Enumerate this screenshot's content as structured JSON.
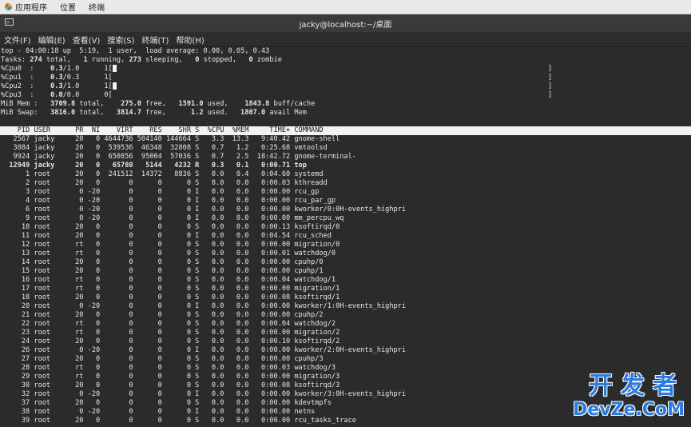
{
  "topbar": {
    "apps": "应用程序",
    "places": "位置",
    "terminal": "终端"
  },
  "window": {
    "title": "jacky@localhost:~/桌面"
  },
  "menubar": [
    "文件(F)",
    "编辑(E)",
    "查看(V)",
    "搜索(S)",
    "终端(T)",
    "帮助(H)"
  ],
  "summary": {
    "top": "top - 04:00:18 up  5:19,  1 user,  load average: 0.00, 0.05, 0.43",
    "tasks": [
      "Tasks: ",
      "274",
      " total,   ",
      "1",
      " running, ",
      "273",
      " sleeping,   ",
      "0",
      " stopped,   ",
      "0",
      " zombie"
    ],
    "cpus": [
      {
        "label": "%Cpu0  :    ",
        "val": "0.3",
        "rest": "/1.0      1["
      },
      {
        "label": "%Cpu1  :    ",
        "val": "0.3",
        "rest": "/0.3      1["
      },
      {
        "label": "%Cpu2  :    ",
        "val": "0.3",
        "rest": "/1.0      1["
      },
      {
        "label": "%Cpu3  :    ",
        "val": "0.0",
        "rest": "/0.0      0["
      }
    ],
    "bracket_close": "]",
    "mem": [
      "MiB Mem :   ",
      "3709.8",
      " total,    ",
      "275.0",
      " free,   ",
      "1591.0",
      " used,    ",
      "1843.8",
      " buff/cache"
    ],
    "swap": [
      "MiB Swap:   ",
      "3816.0",
      " total,   ",
      "3814.7",
      " free,      ",
      "1.2",
      " used.   ",
      "1807.0",
      " avail Mem"
    ]
  },
  "table": {
    "header": "    PID USER      PR  NI    VIRT    RES    SHR S  %CPU  %MEM     TIME+ COMMAND",
    "rows": [
      {
        "text": "   2567 jacky     20   0 4644736 504140 144664 S   3.3  13.3   9:40.42 gnome-shell",
        "bold": false
      },
      {
        "text": "   3084 jacky     20   0  539536  46348  32808 S   0.7   1.2   0:25.68 vmtoolsd",
        "bold": false
      },
      {
        "text": "   9924 jacky     20   0  650856  95004  57036 S   0.7   2.5  18:42.72 gnome-terminal-",
        "bold": false
      },
      {
        "text": "  12949 jacky     20   0   65780   5144   4232 R   0.3   0.1   0:00.71 top",
        "bold": true
      },
      {
        "text": "      1 root      20   0  241512  14372   8836 S   0.0   0.4   0:04.60 systemd",
        "bold": false
      },
      {
        "text": "      2 root      20   0       0      0      0 S   0.0   0.0   0:00.03 kthreadd",
        "bold": false
      },
      {
        "text": "      3 root       0 -20       0      0      0 I   0.0   0.0   0:00.00 rcu_gp",
        "bold": false
      },
      {
        "text": "      4 root       0 -20       0      0      0 I   0.0   0.0   0:00.00 rcu_par_gp",
        "bold": false
      },
      {
        "text": "      6 root       0 -20       0      0      0 I   0.0   0.0   0:00.00 kworker/0:0H-events_highpri",
        "bold": false
      },
      {
        "text": "      9 root       0 -20       0      0      0 I   0.0   0.0   0:00.00 mm_percpu_wq",
        "bold": false
      },
      {
        "text": "     10 root      20   0       0      0      0 S   0.0   0.0   0:00.13 ksoftirqd/0",
        "bold": false
      },
      {
        "text": "     11 root      20   0       0      0      0 I   0.0   0.0   0:04.54 rcu_sched",
        "bold": false
      },
      {
        "text": "     12 root      rt   0       0      0      0 S   0.0   0.0   0:00.00 migration/0",
        "bold": false
      },
      {
        "text": "     13 root      rt   0       0      0      0 S   0.0   0.0   0:00.01 watchdog/0",
        "bold": false
      },
      {
        "text": "     14 root      20   0       0      0      0 S   0.0   0.0   0:00.00 cpuhp/0",
        "bold": false
      },
      {
        "text": "     15 root      20   0       0      0      0 S   0.0   0.0   0:00.00 cpuhp/1",
        "bold": false
      },
      {
        "text": "     16 root      rt   0       0      0      0 S   0.0   0.0   0:00.04 watchdog/1",
        "bold": false
      },
      {
        "text": "     17 root      rt   0       0      0      0 S   0.0   0.0   0:00.00 migration/1",
        "bold": false
      },
      {
        "text": "     18 root      20   0       0      0      0 S   0.0   0.0   0:00.08 ksoftirqd/1",
        "bold": false
      },
      {
        "text": "     20 root       0 -20       0      0      0 I   0.0   0.0   0:00.00 kworker/1:0H-events_highpri",
        "bold": false
      },
      {
        "text": "     21 root      20   0       0      0      0 S   0.0   0.0   0:00.00 cpuhp/2",
        "bold": false
      },
      {
        "text": "     22 root      rt   0       0      0      0 S   0.0   0.0   0:00.04 watchdog/2",
        "bold": false
      },
      {
        "text": "     23 root      rt   0       0      0      0 S   0.0   0.0   0:00.00 migration/2",
        "bold": false
      },
      {
        "text": "     24 root      20   0       0      0      0 S   0.0   0.0   0:00.10 ksoftirqd/2",
        "bold": false
      },
      {
        "text": "     26 root       0 -20       0      0      0 I   0.0   0.0   0:00.00 kworker/2:0H-events_highpri",
        "bold": false
      },
      {
        "text": "     27 root      20   0       0      0      0 S   0.0   0.0   0:00.00 cpuhp/3",
        "bold": false
      },
      {
        "text": "     28 root      rt   0       0      0      0 S   0.0   0.0   0:00.03 watchdog/3",
        "bold": false
      },
      {
        "text": "     29 root      rt   0       0      0      0 S   0.0   0.0   0:00.00 migration/3",
        "bold": false
      },
      {
        "text": "     30 root      20   0       0      0      0 S   0.0   0.0   0:00.08 ksoftirqd/3",
        "bold": false
      },
      {
        "text": "     32 root       0 -20       0      0      0 I   0.0   0.0   0:00.00 kworker/3:0H-events_highpri",
        "bold": false
      },
      {
        "text": "     37 root      20   0       0      0      0 S   0.0   0.0   0:00.00 kdevtmpfs",
        "bold": false
      },
      {
        "text": "     38 root       0 -20       0      0      0 I   0.0   0.0   0:00.00 netns",
        "bold": false
      },
      {
        "text": "     39 root      20   0       0      0      0 S   0.0   0.0   0:00.00 rcu_tasks_trace",
        "bold": false
      }
    ]
  },
  "watermark": {
    "line1": "开发者",
    "line2": "DevZe.CoM"
  }
}
